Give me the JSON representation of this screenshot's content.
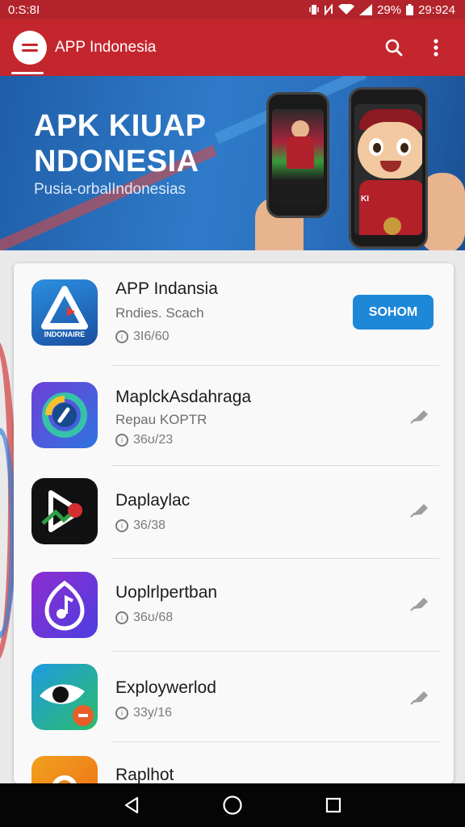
{
  "status_bar": {
    "time": "0:S:8I",
    "battery": "29%",
    "clock": "29:924"
  },
  "app_bar": {
    "title": "APP Indonesia",
    "menu_icon": "hamburger-icon",
    "search_icon": "search-icon",
    "more_icon": "more-vert-icon"
  },
  "banner": {
    "title_line1": "APK KIUAP",
    "title_line2": "NDONESIA",
    "subtitle": "Pusia-orbalIndonesias",
    "mascot_badge": "KI"
  },
  "apps": [
    {
      "name": "APP Indansia",
      "subtitle": "Rndies. Scach",
      "meta": "3I6/60",
      "action": "SOHOM",
      "icon_text": "INDONAIRE",
      "icon_name": "app-indonesia-icon"
    },
    {
      "name": "MaplckAsdahraga",
      "subtitle": "Repau KOPTR",
      "meta": "36ʊ/23",
      "icon_name": "refresh-circle-icon"
    },
    {
      "name": "Daplaylac",
      "meta": "36/38",
      "icon_name": "play-shield-icon"
    },
    {
      "name": "Uoplrlpertban",
      "meta": "36ʊ/68",
      "icon_name": "music-note-icon"
    },
    {
      "name": "Exploywerlod",
      "meta": "33y/16",
      "icon_name": "eye-bird-icon"
    },
    {
      "name": "Raplhot",
      "icon_name": "orange-app-icon"
    }
  ],
  "colors": {
    "primary_red": "#c4262e",
    "status_red": "#b3232b",
    "accent_blue": "#1e88d8"
  }
}
